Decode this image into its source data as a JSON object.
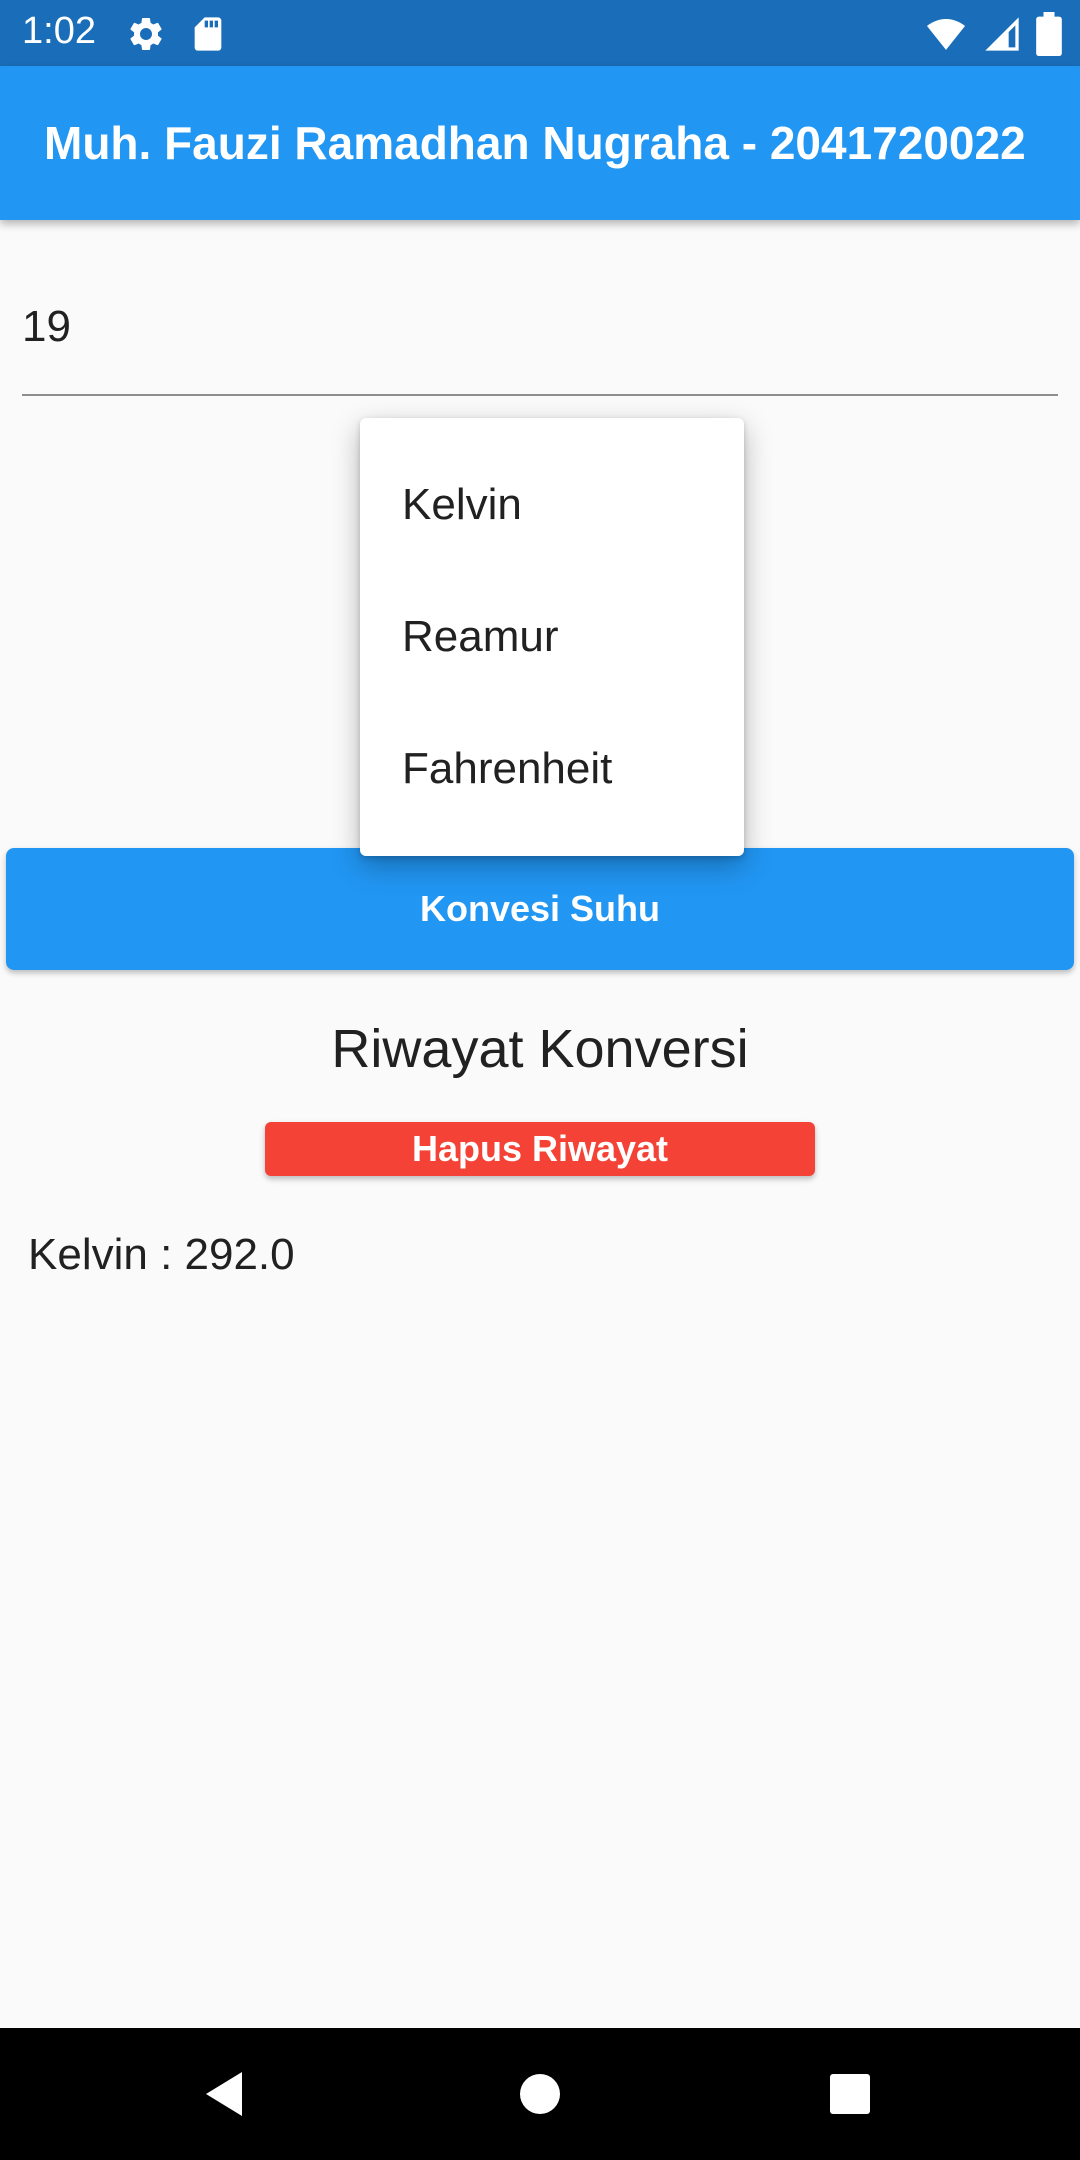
{
  "status_bar": {
    "time": "1:02",
    "left_icons": [
      "gear-icon",
      "sd-card-icon"
    ],
    "right_icons": [
      "wifi-icon",
      "cell-signal-icon",
      "battery-icon"
    ],
    "background_color": "#1a6db8"
  },
  "app_bar": {
    "title": "Muh. Fauzi Ramadhan Nugraha - 2041720022",
    "background_color": "#2196f3"
  },
  "input": {
    "value": "19"
  },
  "dropdown": {
    "options": [
      "Kelvin",
      "Reamur",
      "Fahrenheit"
    ]
  },
  "convert_button": {
    "label": "Konvesi Suhu",
    "color": "#2196f3"
  },
  "history": {
    "title": "Riwayat Konversi",
    "clear_label": "Hapus Riwayat",
    "clear_color": "#f44336",
    "items": [
      "Kelvin : 292.0"
    ]
  },
  "nav_bar": {
    "buttons": [
      "back-icon",
      "home-icon",
      "recents-icon"
    ]
  }
}
